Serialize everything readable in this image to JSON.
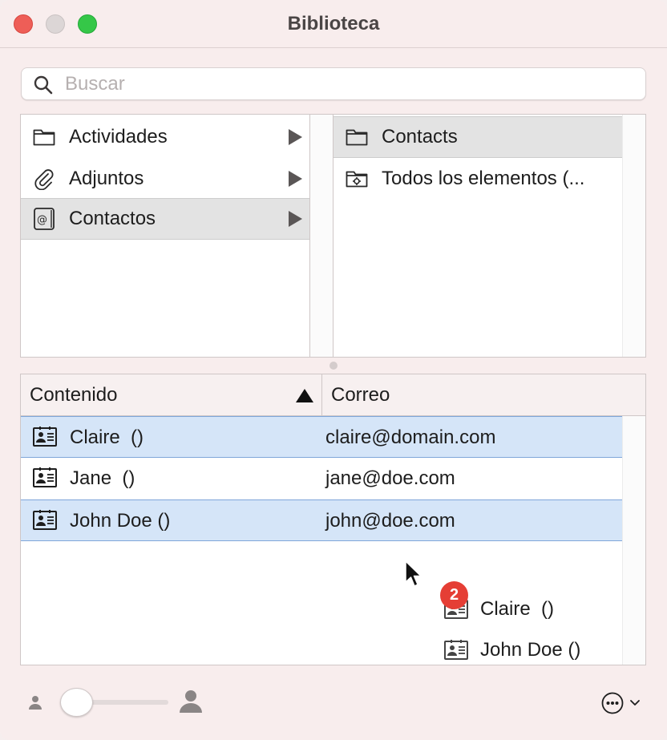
{
  "window": {
    "title": "Biblioteca"
  },
  "search": {
    "placeholder": "Buscar",
    "value": ""
  },
  "categories": [
    {
      "label": "Actividades",
      "icon": "folder-icon"
    },
    {
      "label": "Adjuntos",
      "icon": "paperclip-icon"
    },
    {
      "label": "Contactos",
      "icon": "address-book-icon"
    }
  ],
  "folders": [
    {
      "label": "Contacts",
      "icon": "folder-icon"
    },
    {
      "label": "Todos los elementos (...",
      "icon": "smart-folder-icon"
    }
  ],
  "table": {
    "columns": [
      "Contenido",
      "Correo"
    ],
    "rows": [
      {
        "name": "Claire  ()",
        "email": "claire@domain.com"
      },
      {
        "name": "Jane  ()",
        "email": "jane@doe.com"
      },
      {
        "name": "John Doe ()",
        "email": "john@doe.com"
      }
    ]
  },
  "drag": {
    "count": "2",
    "items": [
      "Claire  ()",
      "John Doe ()"
    ]
  },
  "colors": {
    "selection": "#d5e5f8",
    "badge": "#e53e35",
    "close": "#ee5e57",
    "zoom": "#35c748"
  }
}
